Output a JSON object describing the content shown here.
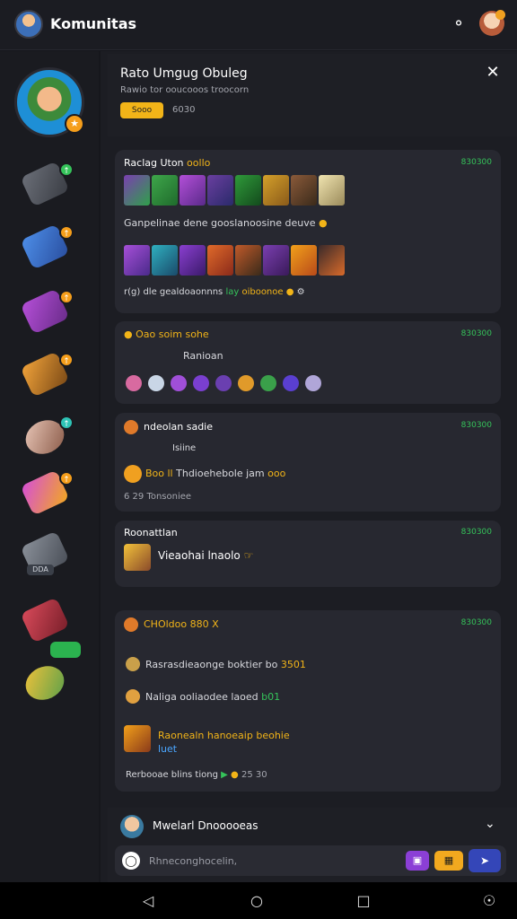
{
  "header": {
    "title": "Komunitas"
  },
  "panel": {
    "title": "Rato Umgug Obuleg",
    "subtitle": "Rawio tor ooucooos troocorn",
    "chip": "Sooo",
    "meta": "6030"
  },
  "cards": [
    {
      "title": "Raclag Uton",
      "title_hl": "oollo",
      "time": "830300",
      "line1": "Ganpelinae dene gooslanoosine deuve",
      "line2": "r(g) dle gealdoaonnns",
      "line2_ok": "lay",
      "line2_hl": "oiboonoe"
    },
    {
      "title": "Oao soim sohe",
      "time": "830300",
      "line1": "Ranioan"
    },
    {
      "title": "ndeolan sadie",
      "time": "830300",
      "line1": "Isiine",
      "line2_hl": "Boo ll",
      "line2": "Thdioehebole jam",
      "line2_tag": "ooo",
      "line3": "6 29 Tonsoniee"
    },
    {
      "title": "Roonattlan",
      "time": "830300",
      "line1": "Vieaohai lnaolo"
    },
    {
      "title_hl": "CHOldoo 880 X",
      "time": "830300",
      "line1": "Rasrasdieaonge boktier bo",
      "line1_hl": "3501",
      "line2": "Naliga ooliaodee laoed",
      "line2_ok": "b01",
      "line3_hl": "Raonealn hanoeaip beohie",
      "line3_bl": "luet",
      "line4": "Rerbooae blins tiong",
      "line4_tag": "25 30"
    }
  ],
  "compose": {
    "title": "Mwelarl Dnooooeas",
    "placeholder": "Rhneconghocelin,"
  },
  "sidebar": {
    "chip": "DDA"
  },
  "icons": [
    "bell-icon",
    "close-icon",
    "chevron-down-icon",
    "back-icon",
    "home-icon",
    "recents-icon",
    "accessibility-icon"
  ],
  "colors": {
    "accent_yellow": "#f2b418",
    "accent_green": "#35c35a",
    "bg": "#16171c",
    "card": "#272830"
  }
}
